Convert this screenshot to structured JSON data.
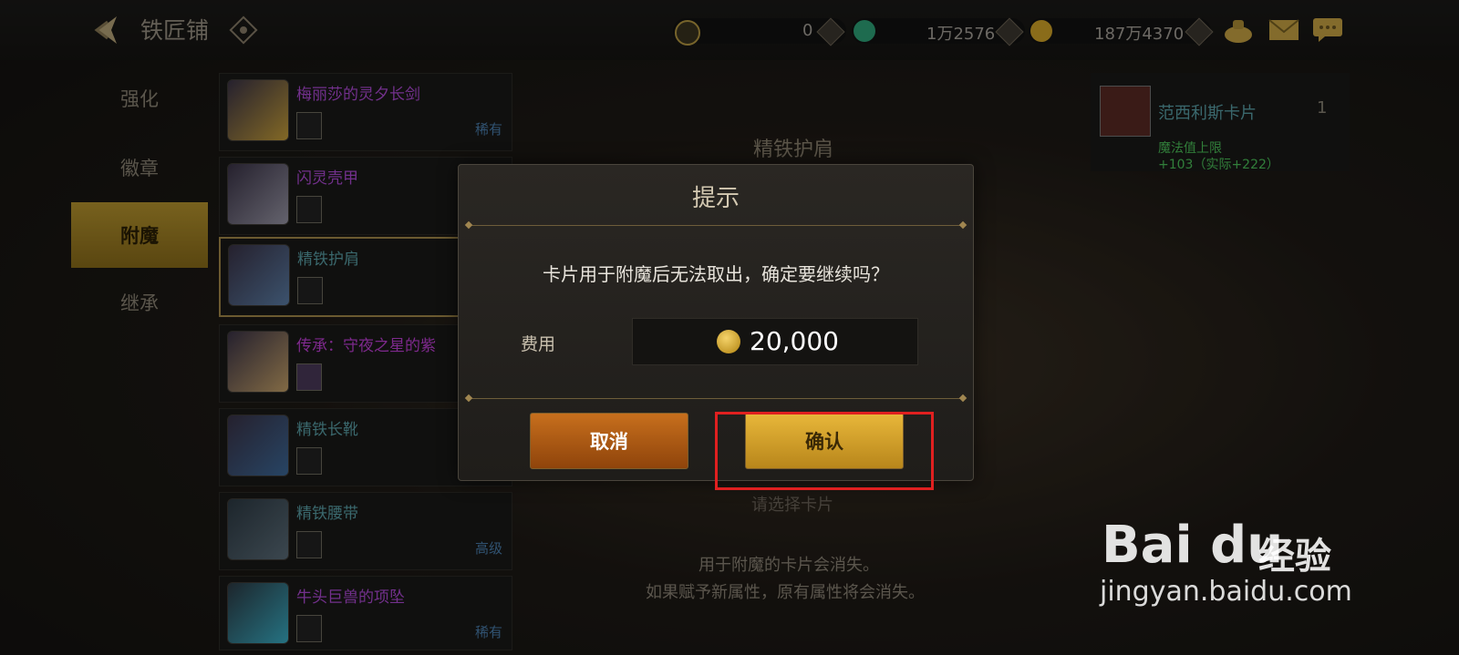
{
  "header": {
    "title": "铁匠铺",
    "currencies": [
      {
        "icon": "c-coin-icon",
        "value": "0"
      },
      {
        "icon": "gem-icon",
        "value": "1万2576"
      },
      {
        "icon": "gold-coin-icon",
        "value": "187万4370"
      }
    ]
  },
  "nav": {
    "items": [
      "强化",
      "徽章",
      "附魔",
      "继承"
    ],
    "active": "附魔"
  },
  "items": [
    {
      "name": "梅丽莎的灵夕长剑",
      "grade": "稀有",
      "name_color": "#b04bd8",
      "grade_color": "#4a7fae"
    },
    {
      "name": "闪灵壳甲",
      "grade": "",
      "name_color": "#b04bd8",
      "grade_color": "#4a7fae"
    },
    {
      "name": "精铁护肩",
      "grade": "",
      "name_color": "#5aa0a8",
      "grade_color": "#4a7fae"
    },
    {
      "name": "传承：守夜之星的紫",
      "grade": "",
      "name_color": "#c13fd8",
      "grade_color": "#4a7fae"
    },
    {
      "name": "精铁长靴",
      "grade": "",
      "name_color": "#5aa0a8",
      "grade_color": "#4a7fae"
    },
    {
      "name": "精铁腰带",
      "grade": "高级",
      "name_color": "#5aa0a8",
      "grade_color": "#4a7fae"
    },
    {
      "name": "牛头巨兽的项坠",
      "grade": "稀有",
      "name_color": "#b04bd8",
      "grade_color": "#4a7fae"
    }
  ],
  "center": {
    "item_title": "精铁护肩",
    "select_card": "请选择卡片",
    "hint_line1": "用于附魔的卡片会消失。",
    "hint_line2": "如果赋予新属性，原有属性将会消失。"
  },
  "card_panel": {
    "name": "范西利斯卡片",
    "count": "1",
    "stat_line1": "魔法值上限",
    "stat_line2": "+103（实际+222）"
  },
  "dialog": {
    "title": "提示",
    "message": "卡片用于附魔后无法取出，确定要继续吗？",
    "fee_label": "费用",
    "fee_value": "20,000",
    "cancel_label": "取消",
    "confirm_label": "确认"
  },
  "watermark": {
    "logo": "Bai du",
    "text": "经验",
    "url": "jingyan.baidu.com"
  }
}
